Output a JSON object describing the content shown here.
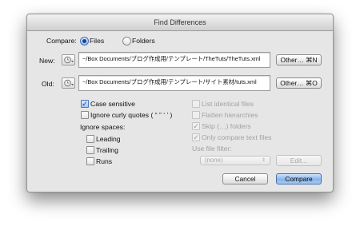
{
  "window": {
    "title": "Find Differences"
  },
  "compare": {
    "label": "Compare:",
    "options": [
      {
        "label": "Files",
        "selected": true
      },
      {
        "label": "Folders",
        "selected": false
      }
    ]
  },
  "new": {
    "label": "New:",
    "path": "~/Box Documents/ブログ作成用/テンプレート/TheTuts/TheTuts.xml",
    "other_button": "Other… ⌘N"
  },
  "old": {
    "label": "Old:",
    "path": "~/Box Documents/ブログ作成用/テンプレート/サイト素材/tuts.xml",
    "other_button": "Other… ⌘O"
  },
  "options_left": {
    "case_sensitive": {
      "label": "Case sensitive",
      "checked": true
    },
    "ignore_curly": {
      "label": "Ignore curly quotes ( “ ” ‘ ’ )",
      "checked": false
    },
    "ignore_spaces_label": "Ignore spaces:",
    "leading": {
      "label": "Leading",
      "checked": false
    },
    "trailing": {
      "label": "Trailing",
      "checked": false
    },
    "runs": {
      "label": "Runs",
      "checked": false
    }
  },
  "options_right": {
    "list_identical": {
      "label": "List identical files",
      "checked": false
    },
    "flatten": {
      "label": "Flatten hierarchies",
      "checked": false
    },
    "skip": {
      "label": "Skip (…) folders",
      "checked": true
    },
    "only_text": {
      "label": "Only compare text files",
      "checked": true
    },
    "use_filter_label": "Use file filter:",
    "filter_value": "(none)",
    "edit_button": "Edit..."
  },
  "buttons": {
    "cancel": "Cancel",
    "compare": "Compare"
  },
  "colors": {
    "accent": "#86b4ea",
    "window_bg": "#e6e6e6"
  }
}
